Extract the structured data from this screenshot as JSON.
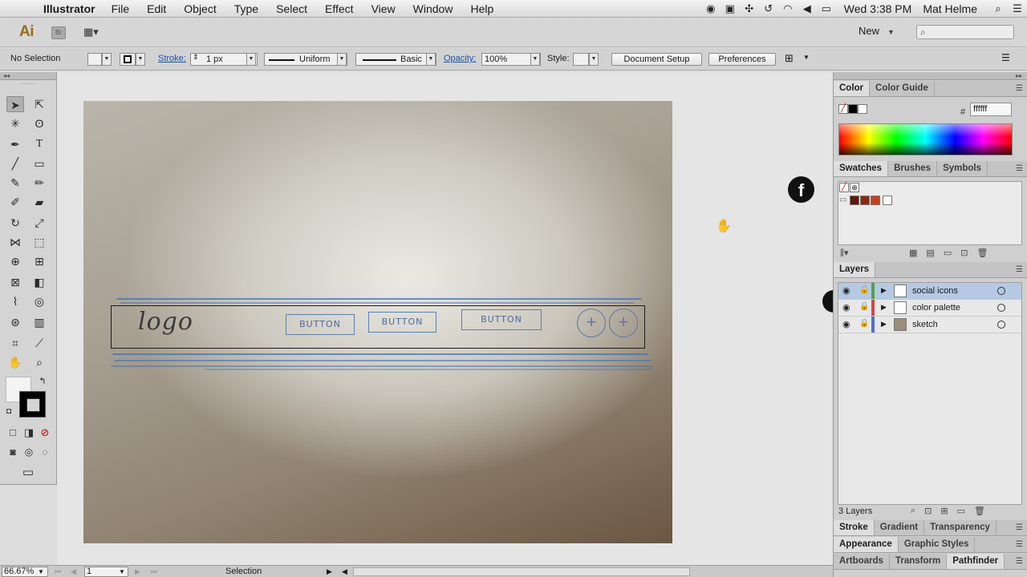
{
  "menubar": {
    "apple_glyph": "",
    "app_name": "Illustrator",
    "items": [
      "File",
      "Edit",
      "Object",
      "Type",
      "Select",
      "Effect",
      "View",
      "Window",
      "Help"
    ],
    "clock": "Wed 3:38 PM",
    "user": "Mat Helme"
  },
  "appbar": {
    "logo": "Ai",
    "bridge": "Br",
    "workspace": "New"
  },
  "control": {
    "selection": "No Selection",
    "stroke_label": "Stroke:",
    "stroke_weight": "1 px",
    "profile": "Uniform",
    "brush": "Basic",
    "opacity_label": "Opacity:",
    "opacity": "100%",
    "style_label": "Style:",
    "doc_setup": "Document Setup",
    "preferences": "Preferences"
  },
  "sketch": {
    "logo_text": "logo",
    "buttons": [
      "BUTTON",
      "BUTTON",
      "BUTTON"
    ],
    "circle_glyph": "+"
  },
  "canvas": {
    "facebook_glyph": "f"
  },
  "panels": {
    "color_tabs": [
      "Color",
      "Color Guide"
    ],
    "hex_label": "#",
    "hex_value": "ffffff",
    "swatch_tabs": [
      "Swatches",
      "Brushes",
      "Symbols"
    ],
    "swatch_colors": [
      "#5a1a0a",
      "#8b2a10",
      "#c2411c",
      "#ffffff"
    ],
    "layers_tab": "Layers",
    "layers": [
      {
        "name": "social icons",
        "color": "#4fa24a",
        "selected": true
      },
      {
        "name": "color palette",
        "color": "#d24545",
        "selected": false
      },
      {
        "name": "sketch",
        "color": "#4d6fd6",
        "selected": false
      }
    ],
    "layers_count": "3 Layers",
    "stroke_tabs": [
      "Stroke",
      "Gradient",
      "Transparency"
    ],
    "appearance_tabs": [
      "Appearance",
      "Graphic Styles"
    ],
    "artboard_tabs": [
      "Artboards",
      "Transform",
      "Pathfinder"
    ]
  },
  "status": {
    "zoom": "66.67%",
    "artboard": "1",
    "tool": "Selection"
  },
  "colors": {
    "link": "#1a52a8",
    "selected_layer": "#b5c9e2"
  }
}
